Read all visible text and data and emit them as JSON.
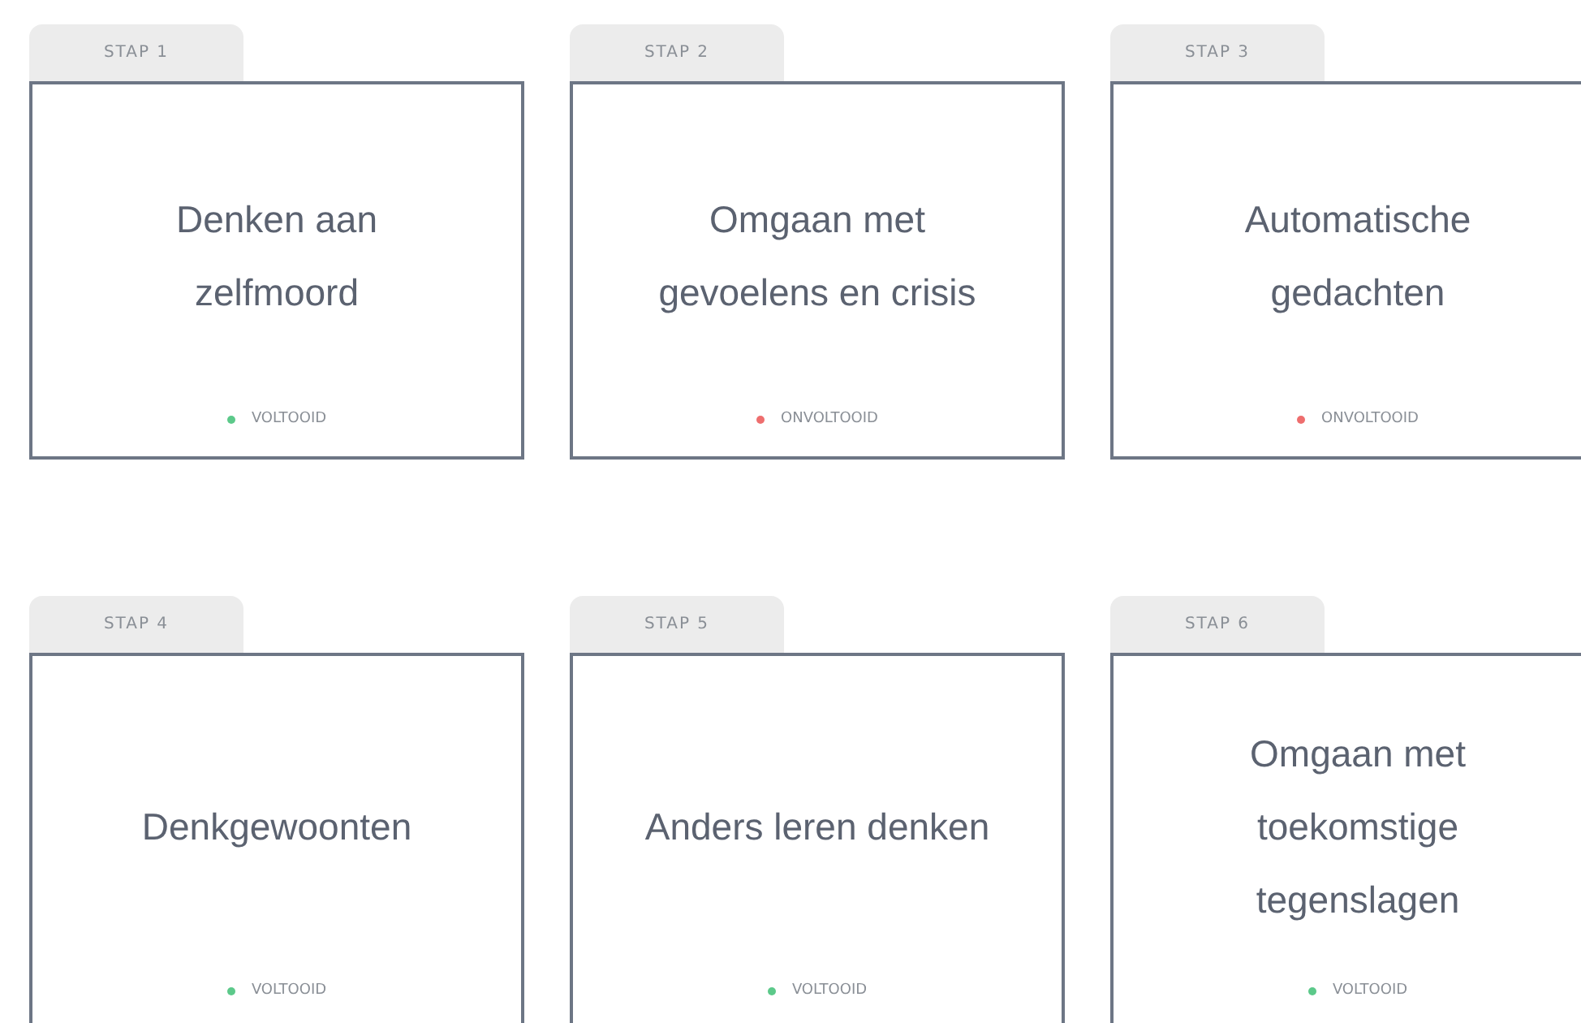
{
  "steps": [
    {
      "tab": "STAP 1",
      "title": "Denken aan zelfmoord",
      "status": "VOLTOOID",
      "color": "#5cc98a"
    },
    {
      "tab": "STAP 2",
      "title": "Omgaan met gevoelens en crisis",
      "status": "ONVOLTOOID",
      "color": "#ee6e6e"
    },
    {
      "tab": "STAP 3",
      "title": "Automatische gedachten",
      "status": "ONVOLTOOID",
      "color": "#ee6e6e"
    },
    {
      "tab": "STAP 4",
      "title": "Denkgewoonten",
      "status": "VOLTOOID",
      "color": "#5cc98a"
    },
    {
      "tab": "STAP 5",
      "title": "Anders leren denken",
      "status": "VOLTOOID",
      "color": "#5cc98a"
    },
    {
      "tab": "STAP 6",
      "title": "Omgaan met toekomstige tegenslagen",
      "status": "VOLTOOID",
      "color": "#5cc98a"
    }
  ]
}
